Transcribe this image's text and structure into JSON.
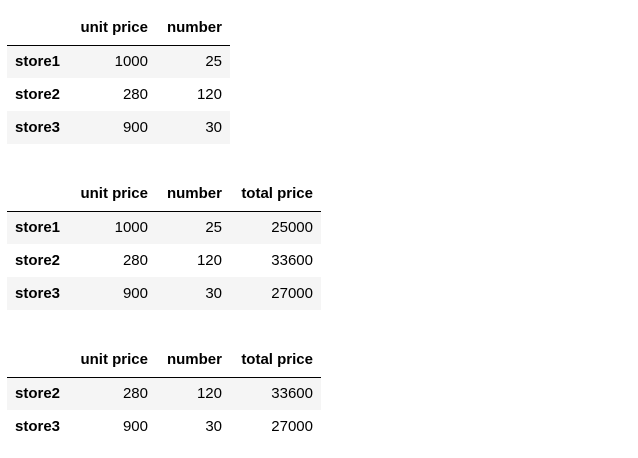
{
  "tables": [
    {
      "columns": [
        "unit price",
        "number"
      ],
      "rows": [
        {
          "index": "store1",
          "cells": [
            "1000",
            "25"
          ]
        },
        {
          "index": "store2",
          "cells": [
            "280",
            "120"
          ]
        },
        {
          "index": "store3",
          "cells": [
            "900",
            "30"
          ]
        }
      ]
    },
    {
      "columns": [
        "unit price",
        "number",
        "total price"
      ],
      "rows": [
        {
          "index": "store1",
          "cells": [
            "1000",
            "25",
            "25000"
          ]
        },
        {
          "index": "store2",
          "cells": [
            "280",
            "120",
            "33600"
          ]
        },
        {
          "index": "store3",
          "cells": [
            "900",
            "30",
            "27000"
          ]
        }
      ]
    },
    {
      "columns": [
        "unit price",
        "number",
        "total price"
      ],
      "rows": [
        {
          "index": "store2",
          "cells": [
            "280",
            "120",
            "33600"
          ]
        },
        {
          "index": "store3",
          "cells": [
            "900",
            "30",
            "27000"
          ]
        }
      ]
    }
  ]
}
